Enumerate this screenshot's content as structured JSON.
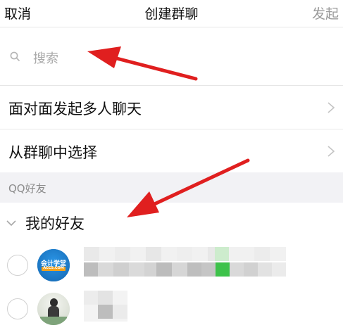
{
  "header": {
    "cancel_label": "取消",
    "title": "创建群聊",
    "launch_label": "发起"
  },
  "search": {
    "placeholder": "搜索"
  },
  "menu": [
    {
      "label": "面对面发起多人聊天"
    },
    {
      "label": "从群聊中选择"
    }
  ],
  "section": {
    "title": "QQ好友"
  },
  "group": {
    "label": "我的好友"
  },
  "friends": [
    {
      "avatar_text": "会计学堂",
      "avatar_sub": "ACC5.COM",
      "name": "",
      "status": ""
    },
    {
      "avatar_text": "",
      "name": "",
      "status": ""
    }
  ],
  "colors": {
    "accent_green": "#3dc24a",
    "arrow_red": "#e01f1f",
    "avatar_blue": "#1a7fd1",
    "avatar_orange": "#f4a21b"
  }
}
